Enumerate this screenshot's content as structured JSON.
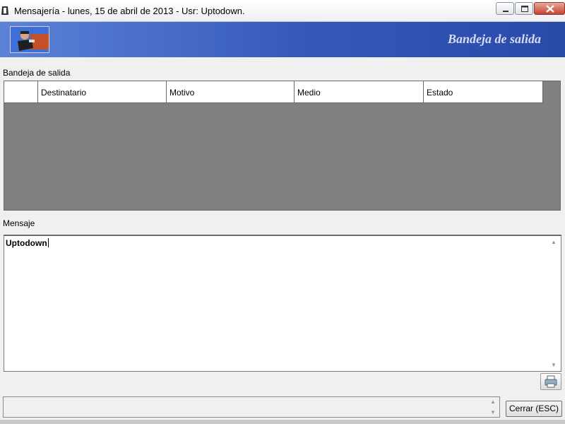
{
  "window": {
    "title": "Mensajería - lunes, 15 de abril de 2013 - Usr: Uptodown.",
    "controls": [
      "minimize-icon",
      "maximize-icon",
      "close-icon"
    ]
  },
  "banner": {
    "title": "Bandeja de salida",
    "logo_icon": "user-figure-logo"
  },
  "outbox": {
    "label": "Bandeja de salida",
    "columns": [
      "",
      "Destinatario",
      "Motivo",
      "Medio",
      "Estado"
    ],
    "rows": []
  },
  "message": {
    "label": "Mensaje",
    "text": "Uptodown"
  },
  "actions": {
    "print_icon": "printer-icon",
    "close_label": "Cerrar (ESC)"
  },
  "colors": {
    "banner_start": "#5c82d8",
    "banner_end": "#2a4aa8",
    "grid_background": "#808080",
    "close_button": "#c7432e"
  }
}
